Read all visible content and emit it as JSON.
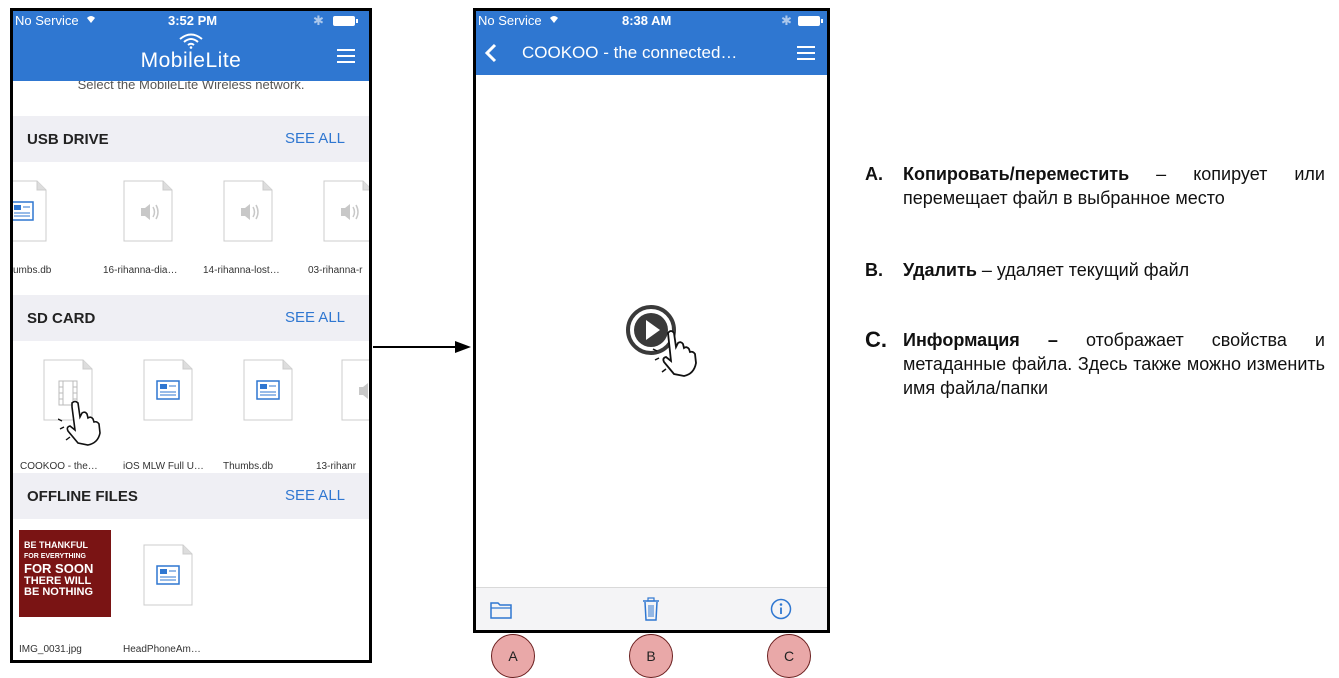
{
  "phone1": {
    "status": {
      "service": "No Service",
      "time": "3:52 PM"
    },
    "nav": {
      "logo": "MobileLite"
    },
    "hint": "Select the MobileLite Wireless network.",
    "usb": {
      "title": "USB DRIVE",
      "see_all": "SEE ALL",
      "items": [
        {
          "name": "umbs.db",
          "icon": "document-icon"
        },
        {
          "name": "16-rihanna-dia…",
          "icon": "audio-file-icon"
        },
        {
          "name": "14-rihanna-lost…",
          "icon": "audio-file-icon"
        },
        {
          "name": "03-rihanna-r",
          "icon": "audio-file-icon"
        }
      ]
    },
    "sd": {
      "title": "SD CARD",
      "see_all": "SEE ALL",
      "items": [
        {
          "name": "COOKOO - the…",
          "icon": "video-file-icon"
        },
        {
          "name": "iOS MLW Full U…",
          "icon": "document-icon"
        },
        {
          "name": "Thumbs.db",
          "icon": "document-icon"
        },
        {
          "name": "13-rihanr",
          "icon": "audio-file-icon"
        }
      ]
    },
    "offline": {
      "title": "OFFLINE FILES",
      "see_all": "SEE ALL",
      "items": [
        {
          "name": "IMG_0031.jpg",
          "icon": "image-thumbnail"
        },
        {
          "name": "HeadPhoneAm…",
          "icon": "document-icon"
        }
      ],
      "thumb_text": [
        "BE THANKFUL",
        "FOR EVERYTHING",
        "FOR SOON",
        "THERE WILL",
        "BE NOTHING"
      ]
    }
  },
  "phone2": {
    "status": {
      "service": "No Service",
      "time": "8:38 AM"
    },
    "nav": {
      "title": "COOKOO - the connected…"
    },
    "bottom_icons": [
      "folder-icon",
      "trash-icon",
      "info-icon"
    ]
  },
  "callouts": {
    "a": "A",
    "b": "B",
    "c": "C"
  },
  "descriptions": [
    {
      "key": "A.",
      "title": "Копировать/переместить",
      "text": "копирует или перемещает файл в выбранное место"
    },
    {
      "key": "B.",
      "title": "Удалить",
      "text": "удаляет текущий файл"
    },
    {
      "key": "C.",
      "title": "Информация –",
      "text": "отображает свойства и метаданные файла. Здесь также можно изменить имя файла/папки"
    }
  ],
  "colors": {
    "accent": "#2f77d1",
    "section_bg": "#efeff4",
    "callout": "#e9a8a8"
  }
}
